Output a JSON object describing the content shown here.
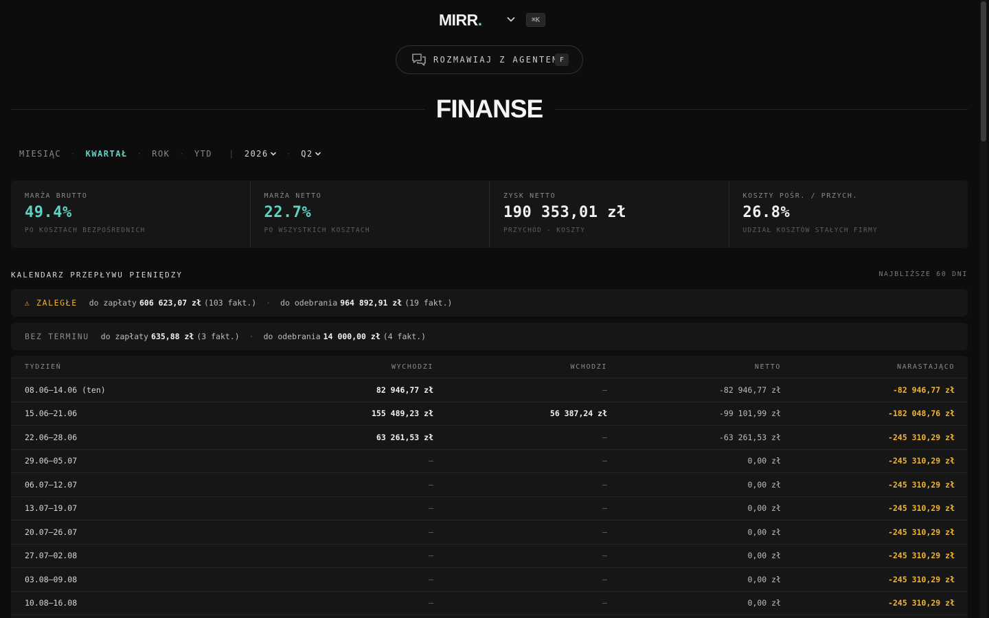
{
  "header": {
    "logo_text": "MIRR",
    "logo_dot": ".",
    "shortcut": "⌘K",
    "agent_button": "ROZMAWIAJ Z AGENTEM",
    "agent_key": "F"
  },
  "page": {
    "title": "FINANSE"
  },
  "periods": {
    "items": [
      "MIESIĄC",
      "KWARTAŁ",
      "ROK",
      "YTD"
    ],
    "active": "KWARTAŁ",
    "year": "2026",
    "quarter": "Q2"
  },
  "kpis": [
    {
      "label": "MARŻA BRUTTO",
      "value": "49.4%",
      "sub": "PO KOSZTACH BEZPOŚREDNICH"
    },
    {
      "label": "MARŻA NETTO",
      "value": "22.7%",
      "sub": "PO WSZYSTKICH KOSZTACH"
    },
    {
      "label": "ZYSK NETTO",
      "value": "190 353,01 zł",
      "sub": "PRZYCHÓD - KOSZTY"
    },
    {
      "label": "KOSZTY POŚR. / PRZYCH.",
      "value": "26.8%",
      "sub": "UDZIAŁ KOSZTÓW STAŁYCH FIRMY"
    }
  ],
  "cashflow": {
    "title": "KALENDARZ PRZEPŁYWU PIENIĘDZY",
    "range": "NAJBLIŻSZE 60 DNI",
    "overdue": {
      "tag": "⚠ ZALEGŁE",
      "pay_label": "do zapłaty",
      "pay_amount": "606 623,07 zł",
      "pay_count": "(103 fakt.)",
      "recv_label": "do odebrania",
      "recv_amount": "964 892,91 zł",
      "recv_count": "(19 fakt.)"
    },
    "no_due": {
      "tag": "BEZ TERMINU",
      "pay_label": "do zapłaty",
      "pay_amount": "635,88 zł",
      "pay_count": "(3 fakt.)",
      "recv_label": "do odebrania",
      "recv_amount": "14 000,00 zł",
      "recv_count": "(4 fakt.)"
    },
    "columns": [
      "TYDZIEŃ",
      "WYCHODZI",
      "WCHODZI",
      "NETTO",
      "NARASTAJĄCO"
    ],
    "rows": [
      {
        "week": "08.06–14.06 (ten)",
        "out": "82 946,77 zł",
        "in": "—",
        "net": "-82 946,77 zł",
        "cum": "-82 946,77 zł"
      },
      {
        "week": "15.06–21.06",
        "out": "155 489,23 zł",
        "in": "56 387,24 zł",
        "net": "-99 101,99 zł",
        "cum": "-182 048,76 zł"
      },
      {
        "week": "22.06–28.06",
        "out": "63 261,53 zł",
        "in": "—",
        "net": "-63 261,53 zł",
        "cum": "-245 310,29 zł"
      },
      {
        "week": "29.06–05.07",
        "out": "—",
        "in": "—",
        "net": "0,00 zł",
        "cum": "-245 310,29 zł"
      },
      {
        "week": "06.07–12.07",
        "out": "—",
        "in": "—",
        "net": "0,00 zł",
        "cum": "-245 310,29 zł"
      },
      {
        "week": "13.07–19.07",
        "out": "—",
        "in": "—",
        "net": "0,00 zł",
        "cum": "-245 310,29 zł"
      },
      {
        "week": "20.07–26.07",
        "out": "—",
        "in": "—",
        "net": "0,00 zł",
        "cum": "-245 310,29 zł"
      },
      {
        "week": "27.07–02.08",
        "out": "—",
        "in": "—",
        "net": "0,00 zł",
        "cum": "-245 310,29 zł"
      },
      {
        "week": "03.08–09.08",
        "out": "—",
        "in": "—",
        "net": "0,00 zł",
        "cum": "-245 310,29 zł"
      },
      {
        "week": "10.08–16.08",
        "out": "—",
        "in": "—",
        "net": "0,00 zł",
        "cum": "-245 310,29 zł"
      }
    ]
  },
  "colors": {
    "accent": "#5fd4c4",
    "warning": "#f2b52e",
    "background": "#0d0d0d",
    "card": "#161616"
  }
}
